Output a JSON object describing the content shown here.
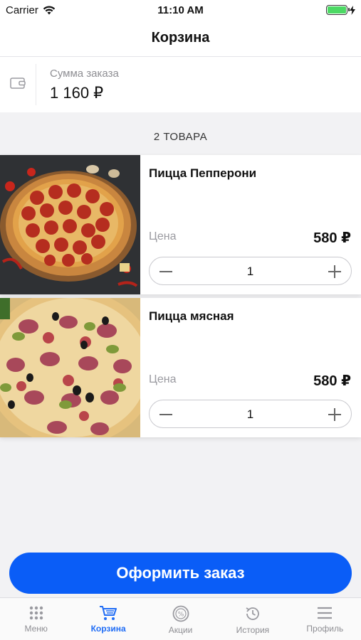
{
  "status_bar": {
    "carrier": "Carrier",
    "time": "11:10 AM"
  },
  "header": {
    "title": "Корзина"
  },
  "summary": {
    "label": "Сумма заказа",
    "value": "1 160 ₽",
    "icon": "wallet-icon"
  },
  "cart": {
    "count_label": "2 ТОВАРА",
    "items": [
      {
        "name": "Пицца Пепперони",
        "price_label": "Цена",
        "price": "580 ₽",
        "quantity": "1"
      },
      {
        "name": "Пицца мясная",
        "price_label": "Цена",
        "price": "580 ₽",
        "quantity": "1"
      }
    ]
  },
  "checkout": {
    "label": "Оформить заказ"
  },
  "tabbar": {
    "items": [
      {
        "label": "Меню",
        "icon": "grid-icon"
      },
      {
        "label": "Корзина",
        "icon": "cart-icon",
        "active": true
      },
      {
        "label": "Акции",
        "icon": "discount-icon"
      },
      {
        "label": "История",
        "icon": "history-icon"
      },
      {
        "label": "Профиль",
        "icon": "menu-icon"
      }
    ]
  },
  "colors": {
    "accent": "#0a5df7",
    "active_tab": "#1f6cf5",
    "battery": "#4cd964"
  }
}
